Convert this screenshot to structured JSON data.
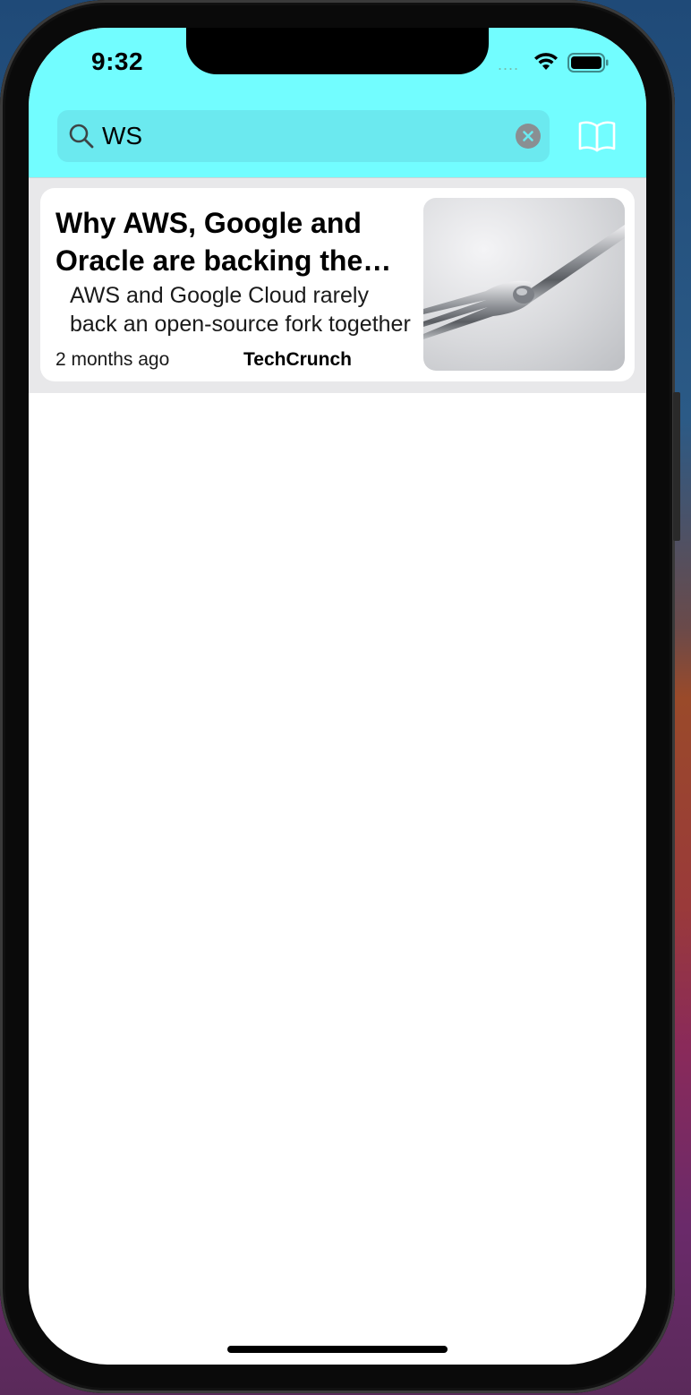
{
  "status_bar": {
    "time": "9:32",
    "signal": "....",
    "wifi_icon": "wifi-icon",
    "battery_icon": "battery-icon"
  },
  "header": {
    "background_color": "#72fdff",
    "search": {
      "value": "WS",
      "icon": "search-icon",
      "clear_icon": "clear-icon"
    },
    "bookmarks_icon": "book-icon"
  },
  "articles": [
    {
      "title": "Why AWS, Google and Oracle are backing the Valkey Redis fork",
      "description": "AWS and Google Cloud rarely back an open-source fork together",
      "time": "2 months ago",
      "source": "TechCrunch",
      "image": "fork-image"
    }
  ]
}
